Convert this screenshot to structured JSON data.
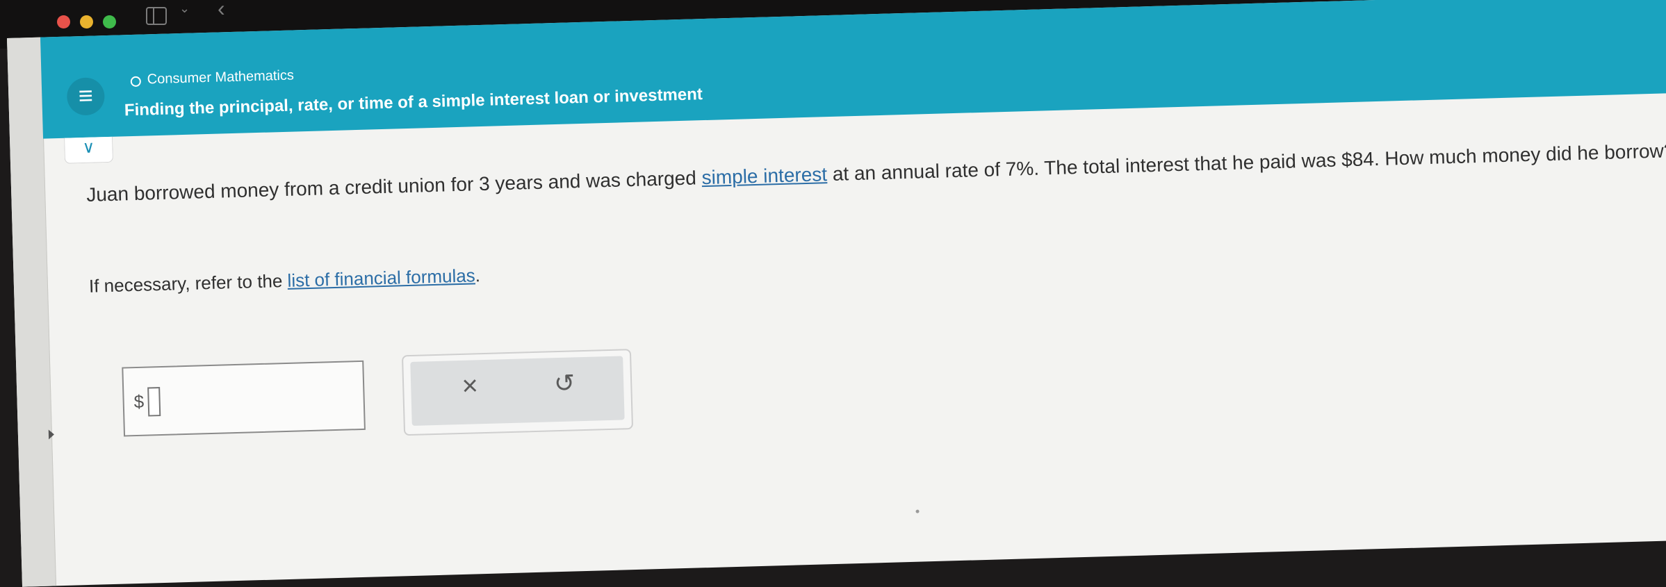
{
  "header": {
    "topic": "Consumer Mathematics",
    "subtitle": "Finding the principal, rate, or time of a simple interest loan or investment"
  },
  "icons": {
    "menu": "≡",
    "collapse": "∨",
    "sidebar_chevron": "⌄",
    "back": "‹",
    "clear": "×",
    "undo": "↺"
  },
  "problem": {
    "part1": "Juan borrowed money from a credit union for 3 years and was charged ",
    "link": "simple interest",
    "part2": " at an annual rate of 7%. The total interest that he paid was $84. How much money did he borrow?"
  },
  "reference": {
    "prefix": "If necessary, refer to the ",
    "link": "list of financial formulas",
    "suffix": "."
  },
  "answer": {
    "currency": "$",
    "value": ""
  }
}
